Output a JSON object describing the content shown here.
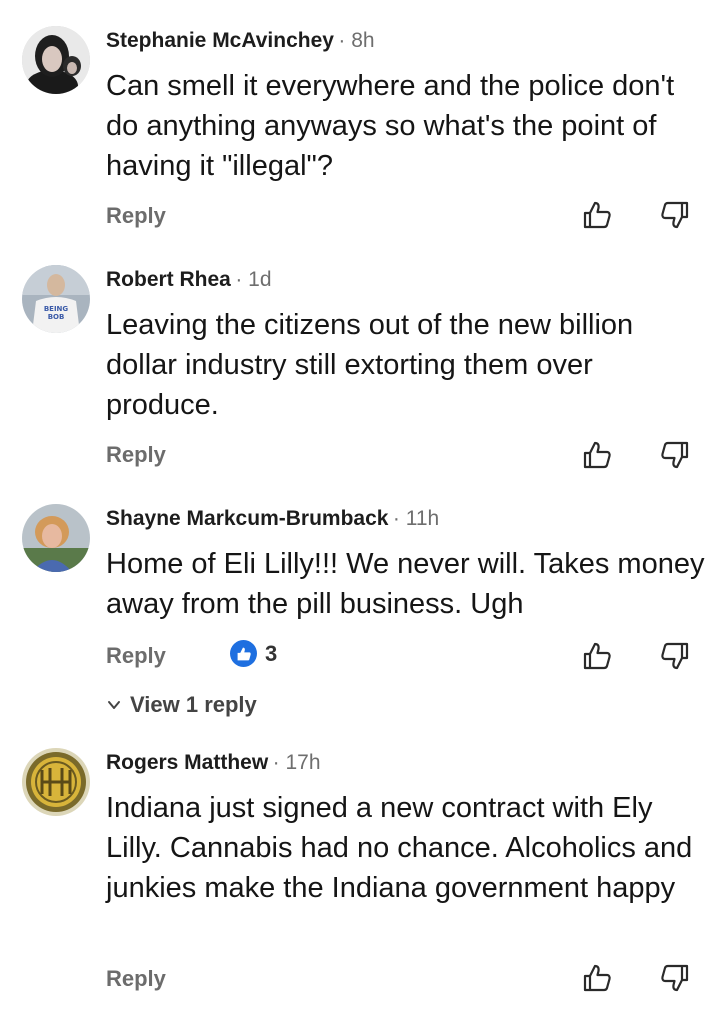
{
  "comments": [
    {
      "author": "Stephanie McAvinchey",
      "time": "· 8h",
      "text": "Can smell it everywhere and the police don't do anything anyways so what's the point of having it \"illegal\"?",
      "reply_label": "Reply"
    },
    {
      "author": "Robert Rhea",
      "time": "· 1d",
      "text": "Leaving the citizens out of the new billion dollar industry still extorting them over produce.",
      "reply_label": "Reply",
      "avatar_text_1": "BEING",
      "avatar_text_2": "BOB"
    },
    {
      "author": "Shayne Markcum-Brumback",
      "time": "· 11h",
      "text": "Home of Eli Lilly!!! We never will. Takes money away from the pill business. Ugh",
      "reply_label": "Reply",
      "reaction_count": "3",
      "view_replies_label": "View 1 reply"
    },
    {
      "author": "Rogers Matthew",
      "time": "· 17h",
      "text": "Indiana just signed a new contract with Ely Lilly. Cannabis had no chance. Alcoholics and junkies make the Indiana government happy",
      "reply_label": "Reply"
    }
  ],
  "icons": {
    "thumbs_up": "thumbs-up-icon",
    "thumbs_down": "thumbs-down-icon",
    "like_reaction": "like-reaction-icon",
    "chevron": "chevron-down-icon"
  },
  "colors": {
    "author": "#1d1d1d",
    "meta": "#6e6e6e",
    "reply": "#6c6c6c",
    "reaction": "#1e6fe0"
  }
}
